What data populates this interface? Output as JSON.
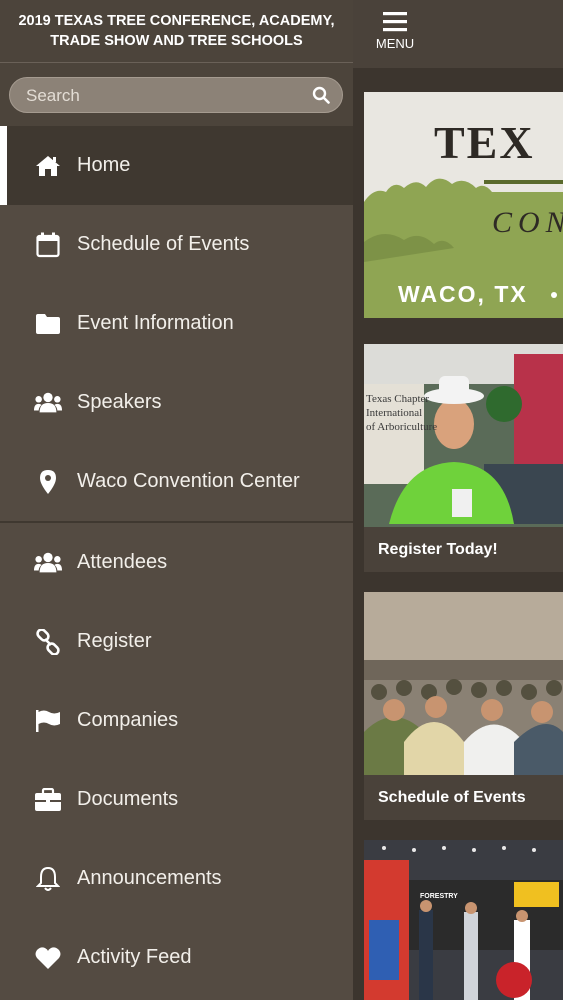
{
  "sidebar": {
    "title": "2019 TEXAS TREE CONFERENCE, ACADEMY,\nTRADE SHOW AND TREE SCHOOLS",
    "search_placeholder": "Search",
    "items": [
      {
        "label": "Home",
        "icon": "home-icon",
        "active": true
      },
      {
        "label": "Schedule of Events",
        "icon": "calendar-icon"
      },
      {
        "label": "Event Information",
        "icon": "folder-icon"
      },
      {
        "label": "Speakers",
        "icon": "users-icon"
      },
      {
        "label": "Waco Convention Center",
        "icon": "map-pin-icon"
      },
      {
        "label": "Attendees",
        "icon": "users-icon"
      },
      {
        "label": "Register",
        "icon": "link-icon"
      },
      {
        "label": "Companies",
        "icon": "flag-icon"
      },
      {
        "label": "Documents",
        "icon": "briefcase-icon"
      },
      {
        "label": "Announcements",
        "icon": "bell-icon"
      },
      {
        "label": "Activity Feed",
        "icon": "heart-icon"
      }
    ]
  },
  "topbar": {
    "menu_label": "MENU"
  },
  "banner": {
    "title_partial": "TEX",
    "subtitle_partial": "CON",
    "location": "WACO, TX"
  },
  "cards": [
    {
      "caption": "Register Today!",
      "photo_sign": "Texas Chapter\nInternational\nof Arboriculture"
    },
    {
      "caption": "Schedule of Events"
    },
    {
      "caption": "",
      "photo_sign": "FORESTRY"
    }
  ],
  "colors": {
    "sidebar_bg": "#544b42",
    "active_bg": "#3f3830",
    "accent_green": "#8fa553"
  }
}
